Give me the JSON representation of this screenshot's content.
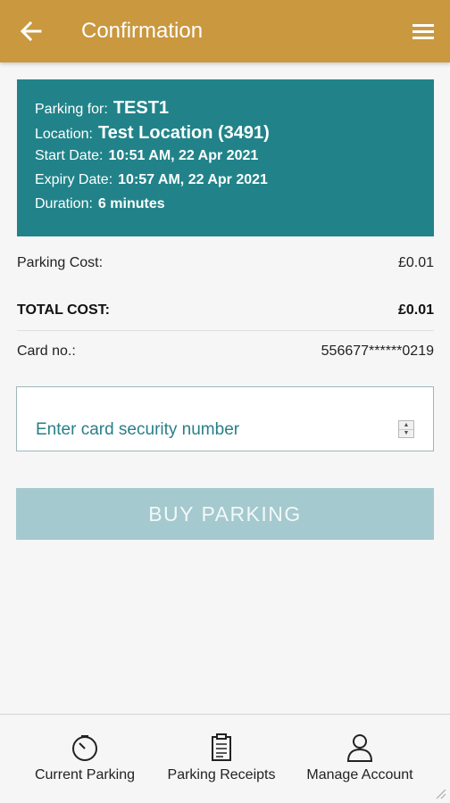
{
  "header": {
    "title": "Confirmation",
    "back_icon": "arrow-left-icon",
    "menu_icon": "hamburger-menu-icon",
    "background": "#c9983f"
  },
  "summary": {
    "background": "#218389",
    "parking_for_label": "Parking for:",
    "parking_for_value": "TEST1",
    "location_label": "Location:",
    "location_value": "Test Location (3491)",
    "start_label": "Start Date:",
    "start_value": "10:51 AM, 22 Apr 2021",
    "expiry_label": "Expiry Date:",
    "expiry_value": "10:57 AM, 22 Apr 2021",
    "duration_label": "Duration:",
    "duration_value": "6 minutes"
  },
  "costs": {
    "parking_cost_label": "Parking Cost:",
    "parking_cost_value": "£0.01",
    "total_label": "TOTAL COST:",
    "total_value": "£0.01",
    "card_label": "Card no.:",
    "card_value": "556677******0219"
  },
  "security": {
    "placeholder": "Enter card security number"
  },
  "buy_button": {
    "label": "BUY PARKING",
    "background": "#a4c9ce"
  },
  "bottom_nav": {
    "items": [
      {
        "label": "Current Parking",
        "icon": "clock-icon"
      },
      {
        "label": "Parking Receipts",
        "icon": "receipt-icon"
      },
      {
        "label": "Manage Account",
        "icon": "user-icon"
      }
    ]
  }
}
